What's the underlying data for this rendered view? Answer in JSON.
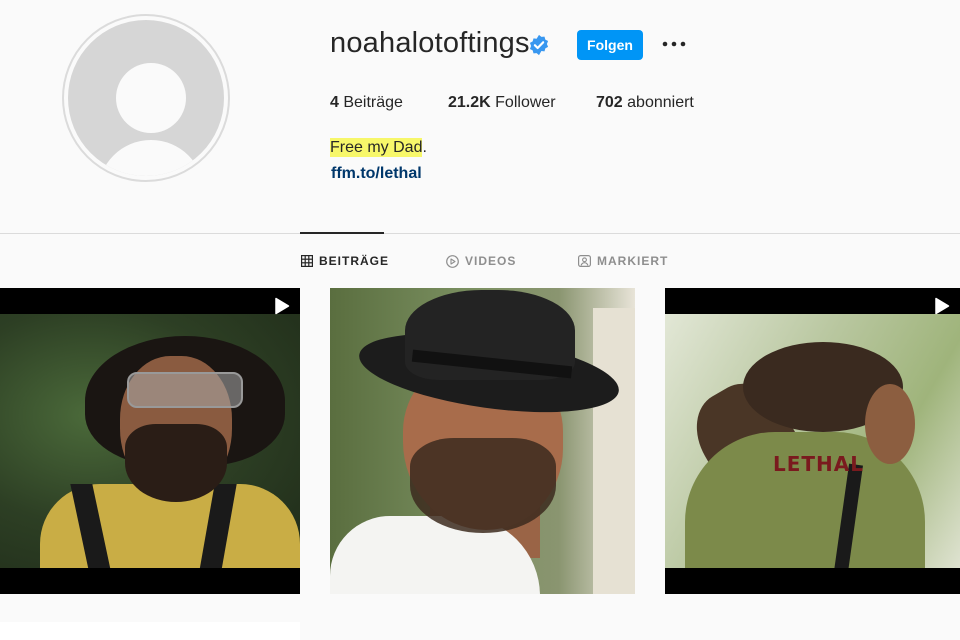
{
  "profile": {
    "username": "noahalotoftings",
    "verified": true,
    "follow_label": "Folgen",
    "more_label": "•••"
  },
  "stats": {
    "posts_count": "4",
    "posts_label": "Beiträge",
    "followers_count": "21.2K",
    "followers_label": "Follower",
    "following_count": "702",
    "following_label": "abonniert"
  },
  "bio": {
    "text_highlighted": "Free my Dad",
    "text_suffix": ".",
    "link": "ffm.to/lethal"
  },
  "tabs": [
    {
      "label": "BEITRÄGE",
      "icon": "grid-icon",
      "active": true
    },
    {
      "label": "VIDEOS",
      "icon": "play-circle-icon",
      "active": false
    },
    {
      "label": "MARKIERT",
      "icon": "tagged-icon",
      "active": false
    }
  ],
  "posts": [
    {
      "type": "video"
    },
    {
      "type": "photo"
    },
    {
      "type": "video",
      "overlay_text": "LETHAL"
    }
  ],
  "colors": {
    "accent": "#0095f6",
    "link": "#00376b",
    "highlight": "#f7f76a",
    "verified": "#3897f0"
  }
}
